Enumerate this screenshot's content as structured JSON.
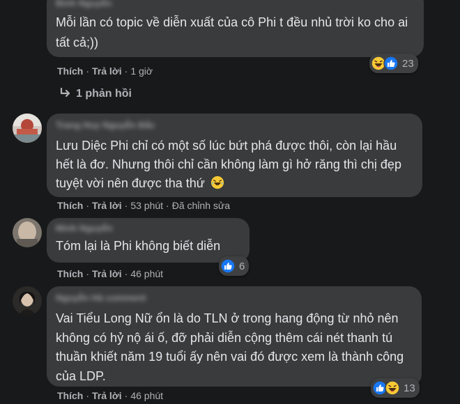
{
  "comments": [
    {
      "author": "Bình Nguyễn",
      "text": "Mỗi lần có topic về diễn xuất của cô Phi t đều nhủ trời ko cho ai tất cả;))",
      "like": "Thích",
      "reply": "Trả lời",
      "time": "1 giờ",
      "reactions": [
        "haha-icon",
        "like-icon"
      ],
      "reaction_count": "23",
      "replies_label": "1 phản hồi"
    },
    {
      "author": "Trang Huy Nguyễn Đắc",
      "text": "Lưu Diệc Phi chỉ có một số lúc bứt phá được thôi, còn lại hầu hết là đơ. Nhưng thôi chỉ cần không làm gì hở răng thì chị đẹp tuyệt vời nên được tha thứ",
      "like": "Thích",
      "reply": "Trả lời",
      "time": "53 phút",
      "edited": "Đã chỉnh sửa"
    },
    {
      "author": "Minh Nguyễn",
      "text": "Tóm lại là Phi không biết diễn",
      "like": "Thích",
      "reply": "Trả lời",
      "time": "46 phút",
      "reactions": [
        "like-icon"
      ],
      "reaction_count": "6"
    },
    {
      "author": "Nguyễn Hà comment",
      "text": "Vai Tiểu Long Nữ ổn là do TLN ở trong hang động từ nhỏ nên không có hỷ nộ ái ố, đỡ phải diễn cộng thêm cái nét thanh tú thuần khiết năm 19 tuổi ấy nên vai đó được xem là thành công của LDP.",
      "like": "Thích",
      "reply": "Trả lời",
      "time": "46 phút",
      "reactions": [
        "like-icon",
        "haha-icon"
      ],
      "reaction_count": "13"
    }
  ]
}
